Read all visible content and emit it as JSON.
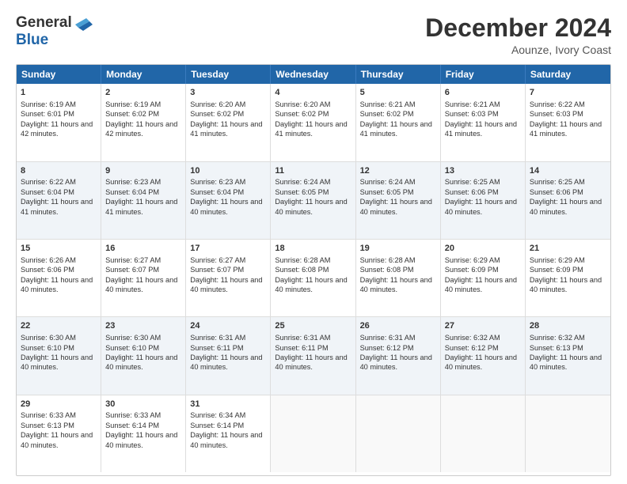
{
  "header": {
    "logo_general": "General",
    "logo_blue": "Blue",
    "month_title": "December 2024",
    "subtitle": "Aounze, Ivory Coast"
  },
  "weekdays": [
    "Sunday",
    "Monday",
    "Tuesday",
    "Wednesday",
    "Thursday",
    "Friday",
    "Saturday"
  ],
  "rows": [
    [
      {
        "day": "1",
        "sunrise": "Sunrise: 6:19 AM",
        "sunset": "Sunset: 6:01 PM",
        "daylight": "Daylight: 11 hours and 42 minutes."
      },
      {
        "day": "2",
        "sunrise": "Sunrise: 6:19 AM",
        "sunset": "Sunset: 6:02 PM",
        "daylight": "Daylight: 11 hours and 42 minutes."
      },
      {
        "day": "3",
        "sunrise": "Sunrise: 6:20 AM",
        "sunset": "Sunset: 6:02 PM",
        "daylight": "Daylight: 11 hours and 41 minutes."
      },
      {
        "day": "4",
        "sunrise": "Sunrise: 6:20 AM",
        "sunset": "Sunset: 6:02 PM",
        "daylight": "Daylight: 11 hours and 41 minutes."
      },
      {
        "day": "5",
        "sunrise": "Sunrise: 6:21 AM",
        "sunset": "Sunset: 6:02 PM",
        "daylight": "Daylight: 11 hours and 41 minutes."
      },
      {
        "day": "6",
        "sunrise": "Sunrise: 6:21 AM",
        "sunset": "Sunset: 6:03 PM",
        "daylight": "Daylight: 11 hours and 41 minutes."
      },
      {
        "day": "7",
        "sunrise": "Sunrise: 6:22 AM",
        "sunset": "Sunset: 6:03 PM",
        "daylight": "Daylight: 11 hours and 41 minutes."
      }
    ],
    [
      {
        "day": "8",
        "sunrise": "Sunrise: 6:22 AM",
        "sunset": "Sunset: 6:04 PM",
        "daylight": "Daylight: 11 hours and 41 minutes."
      },
      {
        "day": "9",
        "sunrise": "Sunrise: 6:23 AM",
        "sunset": "Sunset: 6:04 PM",
        "daylight": "Daylight: 11 hours and 41 minutes."
      },
      {
        "day": "10",
        "sunrise": "Sunrise: 6:23 AM",
        "sunset": "Sunset: 6:04 PM",
        "daylight": "Daylight: 11 hours and 40 minutes."
      },
      {
        "day": "11",
        "sunrise": "Sunrise: 6:24 AM",
        "sunset": "Sunset: 6:05 PM",
        "daylight": "Daylight: 11 hours and 40 minutes."
      },
      {
        "day": "12",
        "sunrise": "Sunrise: 6:24 AM",
        "sunset": "Sunset: 6:05 PM",
        "daylight": "Daylight: 11 hours and 40 minutes."
      },
      {
        "day": "13",
        "sunrise": "Sunrise: 6:25 AM",
        "sunset": "Sunset: 6:06 PM",
        "daylight": "Daylight: 11 hours and 40 minutes."
      },
      {
        "day": "14",
        "sunrise": "Sunrise: 6:25 AM",
        "sunset": "Sunset: 6:06 PM",
        "daylight": "Daylight: 11 hours and 40 minutes."
      }
    ],
    [
      {
        "day": "15",
        "sunrise": "Sunrise: 6:26 AM",
        "sunset": "Sunset: 6:06 PM",
        "daylight": "Daylight: 11 hours and 40 minutes."
      },
      {
        "day": "16",
        "sunrise": "Sunrise: 6:27 AM",
        "sunset": "Sunset: 6:07 PM",
        "daylight": "Daylight: 11 hours and 40 minutes."
      },
      {
        "day": "17",
        "sunrise": "Sunrise: 6:27 AM",
        "sunset": "Sunset: 6:07 PM",
        "daylight": "Daylight: 11 hours and 40 minutes."
      },
      {
        "day": "18",
        "sunrise": "Sunrise: 6:28 AM",
        "sunset": "Sunset: 6:08 PM",
        "daylight": "Daylight: 11 hours and 40 minutes."
      },
      {
        "day": "19",
        "sunrise": "Sunrise: 6:28 AM",
        "sunset": "Sunset: 6:08 PM",
        "daylight": "Daylight: 11 hours and 40 minutes."
      },
      {
        "day": "20",
        "sunrise": "Sunrise: 6:29 AM",
        "sunset": "Sunset: 6:09 PM",
        "daylight": "Daylight: 11 hours and 40 minutes."
      },
      {
        "day": "21",
        "sunrise": "Sunrise: 6:29 AM",
        "sunset": "Sunset: 6:09 PM",
        "daylight": "Daylight: 11 hours and 40 minutes."
      }
    ],
    [
      {
        "day": "22",
        "sunrise": "Sunrise: 6:30 AM",
        "sunset": "Sunset: 6:10 PM",
        "daylight": "Daylight: 11 hours and 40 minutes."
      },
      {
        "day": "23",
        "sunrise": "Sunrise: 6:30 AM",
        "sunset": "Sunset: 6:10 PM",
        "daylight": "Daylight: 11 hours and 40 minutes."
      },
      {
        "day": "24",
        "sunrise": "Sunrise: 6:31 AM",
        "sunset": "Sunset: 6:11 PM",
        "daylight": "Daylight: 11 hours and 40 minutes."
      },
      {
        "day": "25",
        "sunrise": "Sunrise: 6:31 AM",
        "sunset": "Sunset: 6:11 PM",
        "daylight": "Daylight: 11 hours and 40 minutes."
      },
      {
        "day": "26",
        "sunrise": "Sunrise: 6:31 AM",
        "sunset": "Sunset: 6:12 PM",
        "daylight": "Daylight: 11 hours and 40 minutes."
      },
      {
        "day": "27",
        "sunrise": "Sunrise: 6:32 AM",
        "sunset": "Sunset: 6:12 PM",
        "daylight": "Daylight: 11 hours and 40 minutes."
      },
      {
        "day": "28",
        "sunrise": "Sunrise: 6:32 AM",
        "sunset": "Sunset: 6:13 PM",
        "daylight": "Daylight: 11 hours and 40 minutes."
      }
    ],
    [
      {
        "day": "29",
        "sunrise": "Sunrise: 6:33 AM",
        "sunset": "Sunset: 6:13 PM",
        "daylight": "Daylight: 11 hours and 40 minutes."
      },
      {
        "day": "30",
        "sunrise": "Sunrise: 6:33 AM",
        "sunset": "Sunset: 6:14 PM",
        "daylight": "Daylight: 11 hours and 40 minutes."
      },
      {
        "day": "31",
        "sunrise": "Sunrise: 6:34 AM",
        "sunset": "Sunset: 6:14 PM",
        "daylight": "Daylight: 11 hours and 40 minutes."
      },
      null,
      null,
      null,
      null
    ]
  ],
  "alt_rows": [
    false,
    true,
    false,
    true,
    false
  ]
}
